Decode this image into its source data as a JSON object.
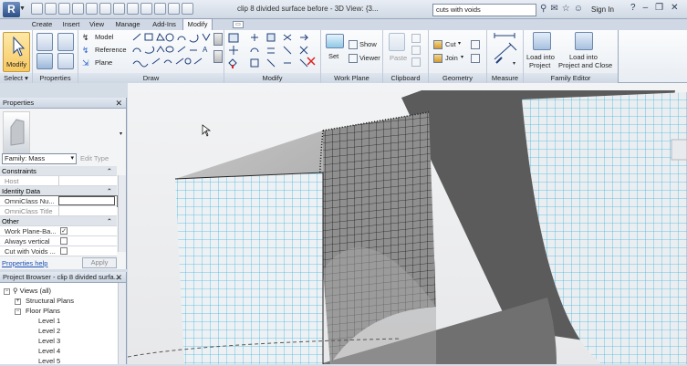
{
  "titlebar": {
    "logo_letter": "R",
    "doc_title": "clip 8 divided surface before - 3D View: {3...",
    "search_value": "cuts with voids",
    "sign_in": "Sign In",
    "help": "?"
  },
  "tabs": [
    "Create",
    "Insert",
    "View",
    "Manage",
    "Add-Ins",
    "Modify"
  ],
  "active_tab": "Modify",
  "ribbon": {
    "select_panel": {
      "button": "Modify",
      "label": "Select ▾"
    },
    "properties_panel": {
      "label": "Properties"
    },
    "draw_panel": {
      "model": "Model",
      "reference": "Reference",
      "plane": "Plane",
      "label": "Draw"
    },
    "modify_panel": {
      "label": "Modify"
    },
    "workplane_panel": {
      "set": "Set",
      "show": "Show",
      "viewer": "Viewer",
      "label": "Work Plane"
    },
    "clipboard_panel": {
      "paste": "Paste",
      "label": "Clipboard"
    },
    "geometry_panel": {
      "cut": "Cut",
      "join": "Join",
      "label": "Geometry"
    },
    "measure_panel": {
      "label": "Measure"
    },
    "family_editor_panel": {
      "load_project_1": "Load into",
      "load_project_2": "Project",
      "load_close_1": "Load into",
      "load_close_2": "Project and Close",
      "label": "Family Editor"
    }
  },
  "properties": {
    "title": "Properties",
    "family_select": "Family: Mass",
    "edit_type": "Edit Type",
    "rows": [
      {
        "label": "Constraints",
        "group": true
      },
      {
        "label": "Host",
        "group": false
      },
      {
        "label": "Identity Data",
        "group": true
      },
      {
        "label": "OmniClass Nu...",
        "group": false
      },
      {
        "label": "OmniClass Title",
        "group": false
      },
      {
        "label": "Other",
        "group": true
      },
      {
        "label": "Work Plane-Ba...",
        "group": false
      },
      {
        "label": "Always vertical",
        "group": false
      },
      {
        "label": "Cut with Voids ...",
        "group": false
      }
    ],
    "help_link": "Properties help",
    "apply": "Apply"
  },
  "project_browser": {
    "title": "Project Browser - clip 8 divided surfa...",
    "nodes": [
      "Views (all)",
      "Structural Plans",
      "Floor Plans",
      "Level 1",
      "Level 2",
      "Level 3",
      "Level 4",
      "Level 5"
    ]
  },
  "colors": {
    "accent": "#f7c963",
    "grid": "#3fb6e0",
    "surface": "#8f8f8f"
  }
}
